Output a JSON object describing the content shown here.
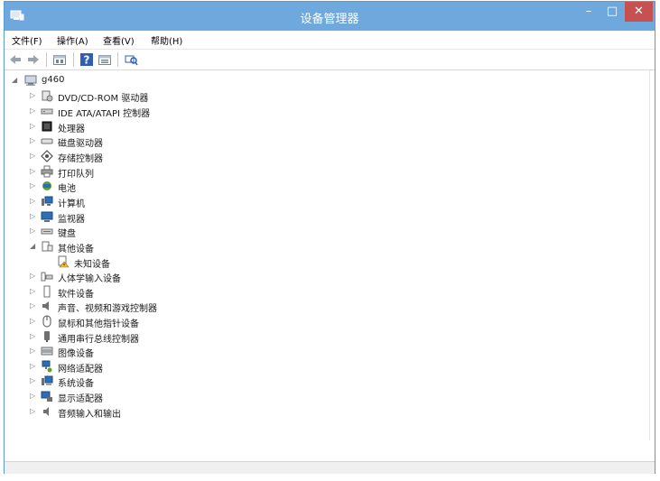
{
  "window": {
    "title": "设备管理器",
    "minimize": "–",
    "maximize": "□",
    "close": "✕"
  },
  "menu": [
    {
      "label": "文件(F)"
    },
    {
      "label": "操作(A)"
    },
    {
      "label": "查看(V)"
    },
    {
      "label": "帮助(H)"
    }
  ],
  "toolbar": [
    {
      "icon": "back-arrow-icon"
    },
    {
      "icon": "forward-arrow-icon"
    },
    {
      "icon": "properties-window-icon"
    },
    {
      "icon": "help-icon"
    },
    {
      "icon": "show-hidden-icon"
    },
    {
      "icon": "scan-hardware-icon"
    }
  ],
  "tree": {
    "root": {
      "label": "g460",
      "icon": "computer-icon"
    },
    "items": [
      {
        "label": "DVD/CD-ROM 驱动器",
        "icon": "dvd-drive-icon"
      },
      {
        "label": "IDE ATA/ATAPI 控制器",
        "icon": "ide-controller-icon"
      },
      {
        "label": "处理器",
        "icon": "processor-icon"
      },
      {
        "label": "磁盘驱动器",
        "icon": "disk-drive-icon"
      },
      {
        "label": "存储控制器",
        "icon": "storage-controller-icon"
      },
      {
        "label": "打印队列",
        "icon": "printer-icon"
      },
      {
        "label": "电池",
        "icon": "battery-icon"
      },
      {
        "label": "计算机",
        "icon": "computer-small-icon"
      },
      {
        "label": "监视器",
        "icon": "monitor-icon"
      },
      {
        "label": "键盘",
        "icon": "keyboard-icon"
      },
      {
        "label": "其他设备",
        "icon": "other-devices-icon",
        "expanded": true
      },
      {
        "label": "未知设备",
        "icon": "unknown-device-warning-icon",
        "child": true
      },
      {
        "label": "人体学输入设备",
        "icon": "hid-icon"
      },
      {
        "label": "软件设备",
        "icon": "software-device-icon"
      },
      {
        "label": "声音、视频和游戏控制器",
        "icon": "sound-icon"
      },
      {
        "label": "鼠标和其他指针设备",
        "icon": "mouse-icon"
      },
      {
        "label": "通用串行总线控制器",
        "icon": "usb-icon"
      },
      {
        "label": "图像设备",
        "icon": "imaging-device-icon"
      },
      {
        "label": "网络适配器",
        "icon": "network-adapter-icon"
      },
      {
        "label": "系统设备",
        "icon": "system-device-icon"
      },
      {
        "label": "显示适配器",
        "icon": "display-adapter-icon"
      },
      {
        "label": "音频输入和输出",
        "icon": "audio-io-icon"
      }
    ]
  }
}
